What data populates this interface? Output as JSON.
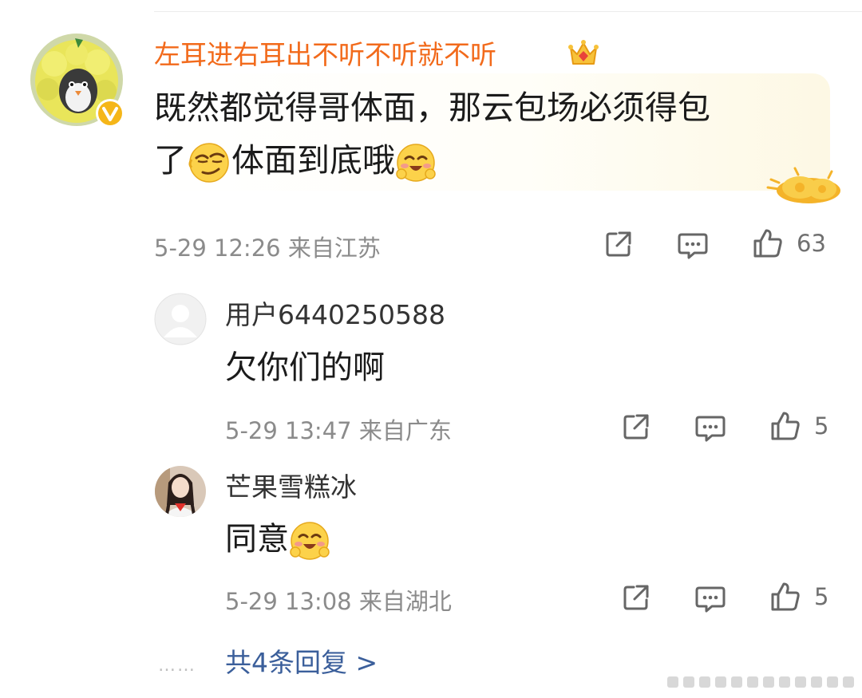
{
  "comment": {
    "username": "左耳进右耳出不听不听就不听",
    "username_color": "#f26a1b",
    "badge_icon": "crown-icon",
    "verified_icon": "verified-v-icon",
    "text_line1": "既然都觉得哥体面，那云包场必须得包",
    "text_line2_a": "了",
    "text_line2_b": "体面到底哦",
    "emoji_1": "smirk-emoji",
    "emoji_2": "blush-hug-emoji",
    "meta": "5-29 12:26 来自江苏",
    "likes": "63"
  },
  "replies": [
    {
      "username": "用户6440250588",
      "avatar": "default-avatar",
      "text": "欠你们的啊",
      "meta": "5-29 13:47 来自广东",
      "likes": "5"
    },
    {
      "username": "芒果雪糕冰",
      "avatar": "girl-avatar",
      "text": "同意",
      "emoji": "blush-hug-emoji",
      "meta": "5-29 13:08 来自湖北",
      "likes": "5"
    }
  ],
  "more": {
    "dots": "……",
    "label": "共4条回复 >"
  },
  "colors": {
    "link": "#3b5f9b",
    "meta": "#8b8b8b",
    "accent": "#f26a1b",
    "verified": "#f5b619"
  }
}
